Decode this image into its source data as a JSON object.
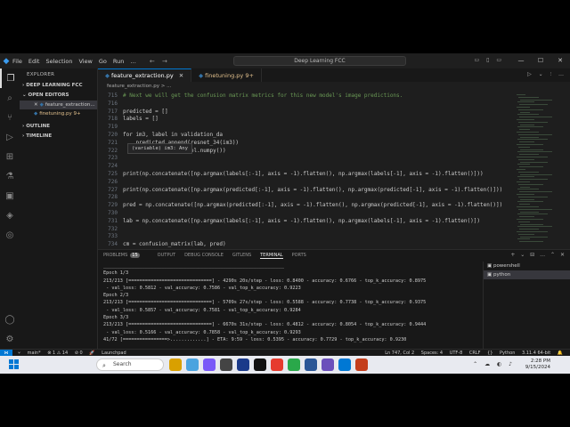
{
  "titlebar": {
    "menu": [
      "File",
      "Edit",
      "Selection",
      "View",
      "Go",
      "Run",
      "…"
    ],
    "search": "Deep Learning FCC"
  },
  "sidebar": {
    "title": "EXPLORER",
    "workspace": "DEEP LEARNING FCC",
    "open_editors": "OPEN EDITORS",
    "files": [
      {
        "name": "feature_extraction...",
        "modified": false
      },
      {
        "name": "finetuning.py  9+",
        "modified": true
      }
    ],
    "outline": "OUTLINE",
    "timeline": "TIMELINE"
  },
  "tabs": [
    {
      "label": "feature_extraction.py",
      "active": true,
      "modified": false
    },
    {
      "label": "finetuning.py  9+",
      "active": false,
      "modified": true
    }
  ],
  "breadcrumb": "feature_extraction.py > ...",
  "editor": {
    "lines": [
      {
        "n": "715",
        "text": "# Next we will get the confusion matrix metrics for this new model's image predictions."
      },
      {
        "n": "716",
        "text": ""
      },
      {
        "n": "717",
        "text": "predicted = []"
      },
      {
        "n": "718",
        "text": "labels = []"
      },
      {
        "n": "719",
        "text": ""
      },
      {
        "n": "720",
        "text": "for im3, label in validation_da"
      },
      {
        "n": "721",
        "text": "    predicted.append(resnet_34(im3))"
      },
      {
        "n": "722",
        "text": "    labels.append(label.numpy())"
      },
      {
        "n": "723",
        "text": ""
      },
      {
        "n": "724",
        "text": ""
      },
      {
        "n": "725",
        "text": "print(np.concatenate([np.argmax(labels[:-1], axis = -1).flatten(), np.argmax(labels[-1], axis = -1).flatten()]))"
      },
      {
        "n": "726",
        "text": ""
      },
      {
        "n": "727",
        "text": "print(np.concatenate([np.argmax(predicted[:-1], axis = -1).flatten(), np.argmax(predicted[-1], axis = -1).flatten()]))"
      },
      {
        "n": "728",
        "text": ""
      },
      {
        "n": "729",
        "text": "pred = np.concatenate([np.argmax(predicted[:-1], axis = -1).flatten(), np.argmax(predicted[-1], axis = -1).flatten()])"
      },
      {
        "n": "730",
        "text": ""
      },
      {
        "n": "731",
        "text": "lab = np.concatenate([np.argmax(labels[:-1], axis = -1).flatten(), np.argmax(labels[-1], axis = -1).flatten()])"
      },
      {
        "n": "732",
        "text": ""
      },
      {
        "n": "733",
        "text": ""
      },
      {
        "n": "734",
        "text": "cm = confusion_matrix(lab, pred)"
      }
    ],
    "hover": "(variable) im3: Any"
  },
  "panel": {
    "tabs": [
      {
        "label": "PROBLEMS",
        "badge": "15"
      },
      {
        "label": "OUTPUT"
      },
      {
        "label": "DEBUG CONSOLE"
      },
      {
        "label": "GITLENS"
      },
      {
        "label": "TERMINAL",
        "active": true
      },
      {
        "label": "PORTS"
      }
    ],
    "terminal": [
      "_________________________________________________________________",
      "Epoch 1/3",
      "213/213 [==============================] - 4290s 20s/step - loss: 0.8400 - accuracy: 0.6766 - top_k_accuracy: 0.8975",
      " - val_loss: 0.5812 - val_accuracy: 0.7586 - val_top_k_accuracy: 0.9223",
      "Epoch 2/3",
      "213/213 [==============================] - 5709s 27s/step - loss: 0.5588 - accuracy: 0.7738 - top_k_accuracy: 0.9375",
      " - val_loss: 0.5857 - val_accuracy: 0.7581 - val_top_k_accuracy: 0.9284",
      "Epoch 3/3",
      "213/213 [==============================] - 6670s 31s/step - loss: 0.4812 - accuracy: 0.8054 - top_k_accuracy: 0.9444",
      " - val_loss: 0.5166 - val_accuracy: 0.7858 - val_top_k_accuracy: 0.9293",
      "41/72 [================>.............] - ETA: 9:59 - loss: 0.5395 - accuracy: 0.7729 - top_k_accuracy: 0.9230"
    ],
    "terminals": [
      {
        "label": "powershell",
        "selected": false
      },
      {
        "label": "python",
        "selected": true
      }
    ]
  },
  "status": {
    "branch": "main*",
    "problems": "⊗ 1  ⚠ 14",
    "ports": "⊘ 0",
    "launchpad": "Launchpad",
    "position": "Ln 747, Col 2",
    "spaces": "Spaces: 4",
    "encoding": "UTF-8",
    "eol": "CRLF",
    "language": "Python",
    "interpreter": "3.11.4 64-bit"
  },
  "taskbar": {
    "search": "Search",
    "time": "2:28 PM",
    "date": "9/15/2024"
  }
}
